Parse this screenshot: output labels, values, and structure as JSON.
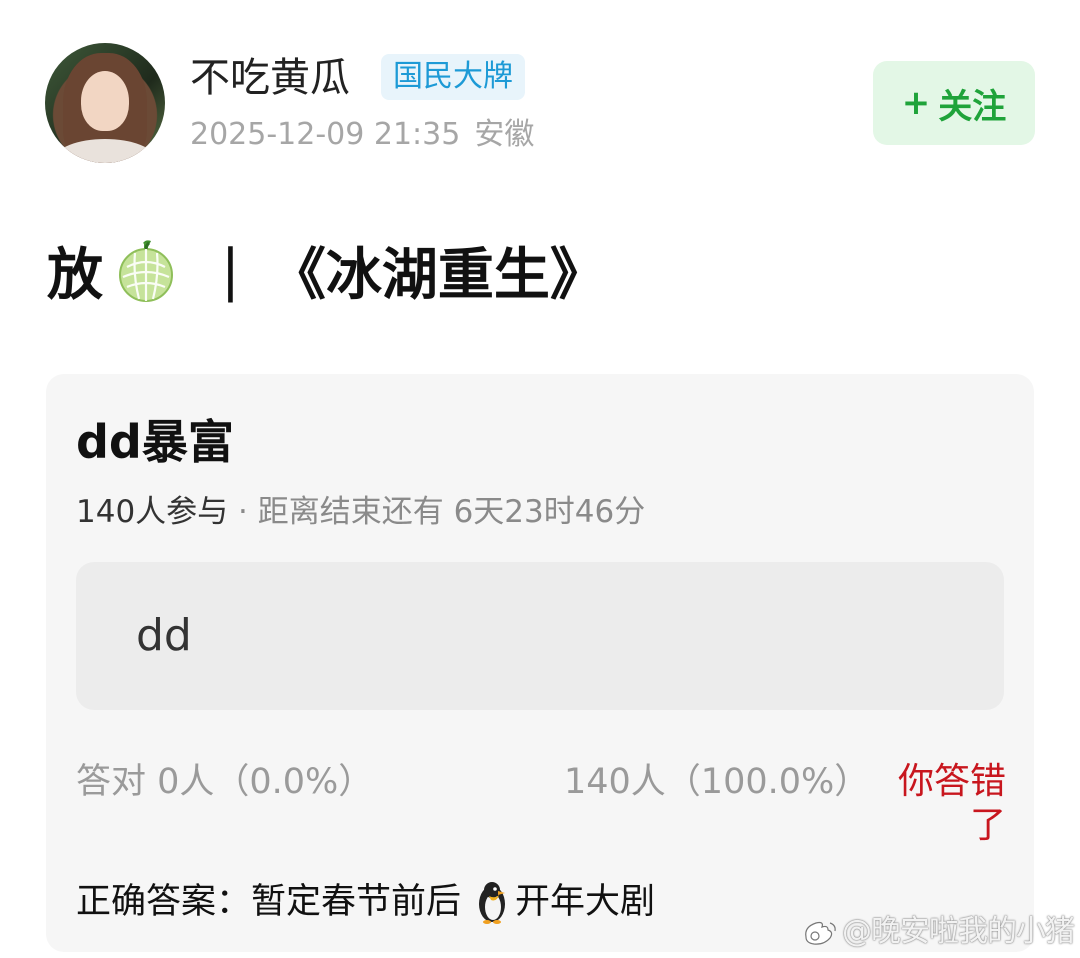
{
  "header": {
    "username": "不吃黄瓜",
    "badge": "国民大牌",
    "timestamp": "2025-12-09 21:35",
    "location": "安徽",
    "follow_label": "关注",
    "follow_plus": "+",
    "avatar_icon": "profile-photo"
  },
  "post": {
    "title_prefix": "放",
    "title_icon": "melon-emoji",
    "title_separator": "|",
    "title_text": "《冰湖重生》"
  },
  "quiz": {
    "title": "dd暴富",
    "participants": "140人参与",
    "dot": " · ",
    "time_left": "距离结束还有 6天23时46分",
    "option_label": "dd",
    "correct_label": "答对  0人（0.0%）",
    "wrong_count": "140人（100.0%）",
    "wrong_message": "你答错了",
    "answer_prefix": "正确答案：暂定春节前后",
    "answer_icon": "penguin-emoji",
    "answer_suffix": "开年大剧"
  },
  "watermark": {
    "text": "@晚安啦我的小猪",
    "icon": "weibo-icon"
  },
  "colors": {
    "badge_text": "#1d9ad6",
    "badge_bg": "#e8f4fb",
    "follow_text": "#1fa33a",
    "follow_bg": "#e3f7e6",
    "wrong_text": "#c8161e",
    "card_bg": "#f6f6f6"
  }
}
